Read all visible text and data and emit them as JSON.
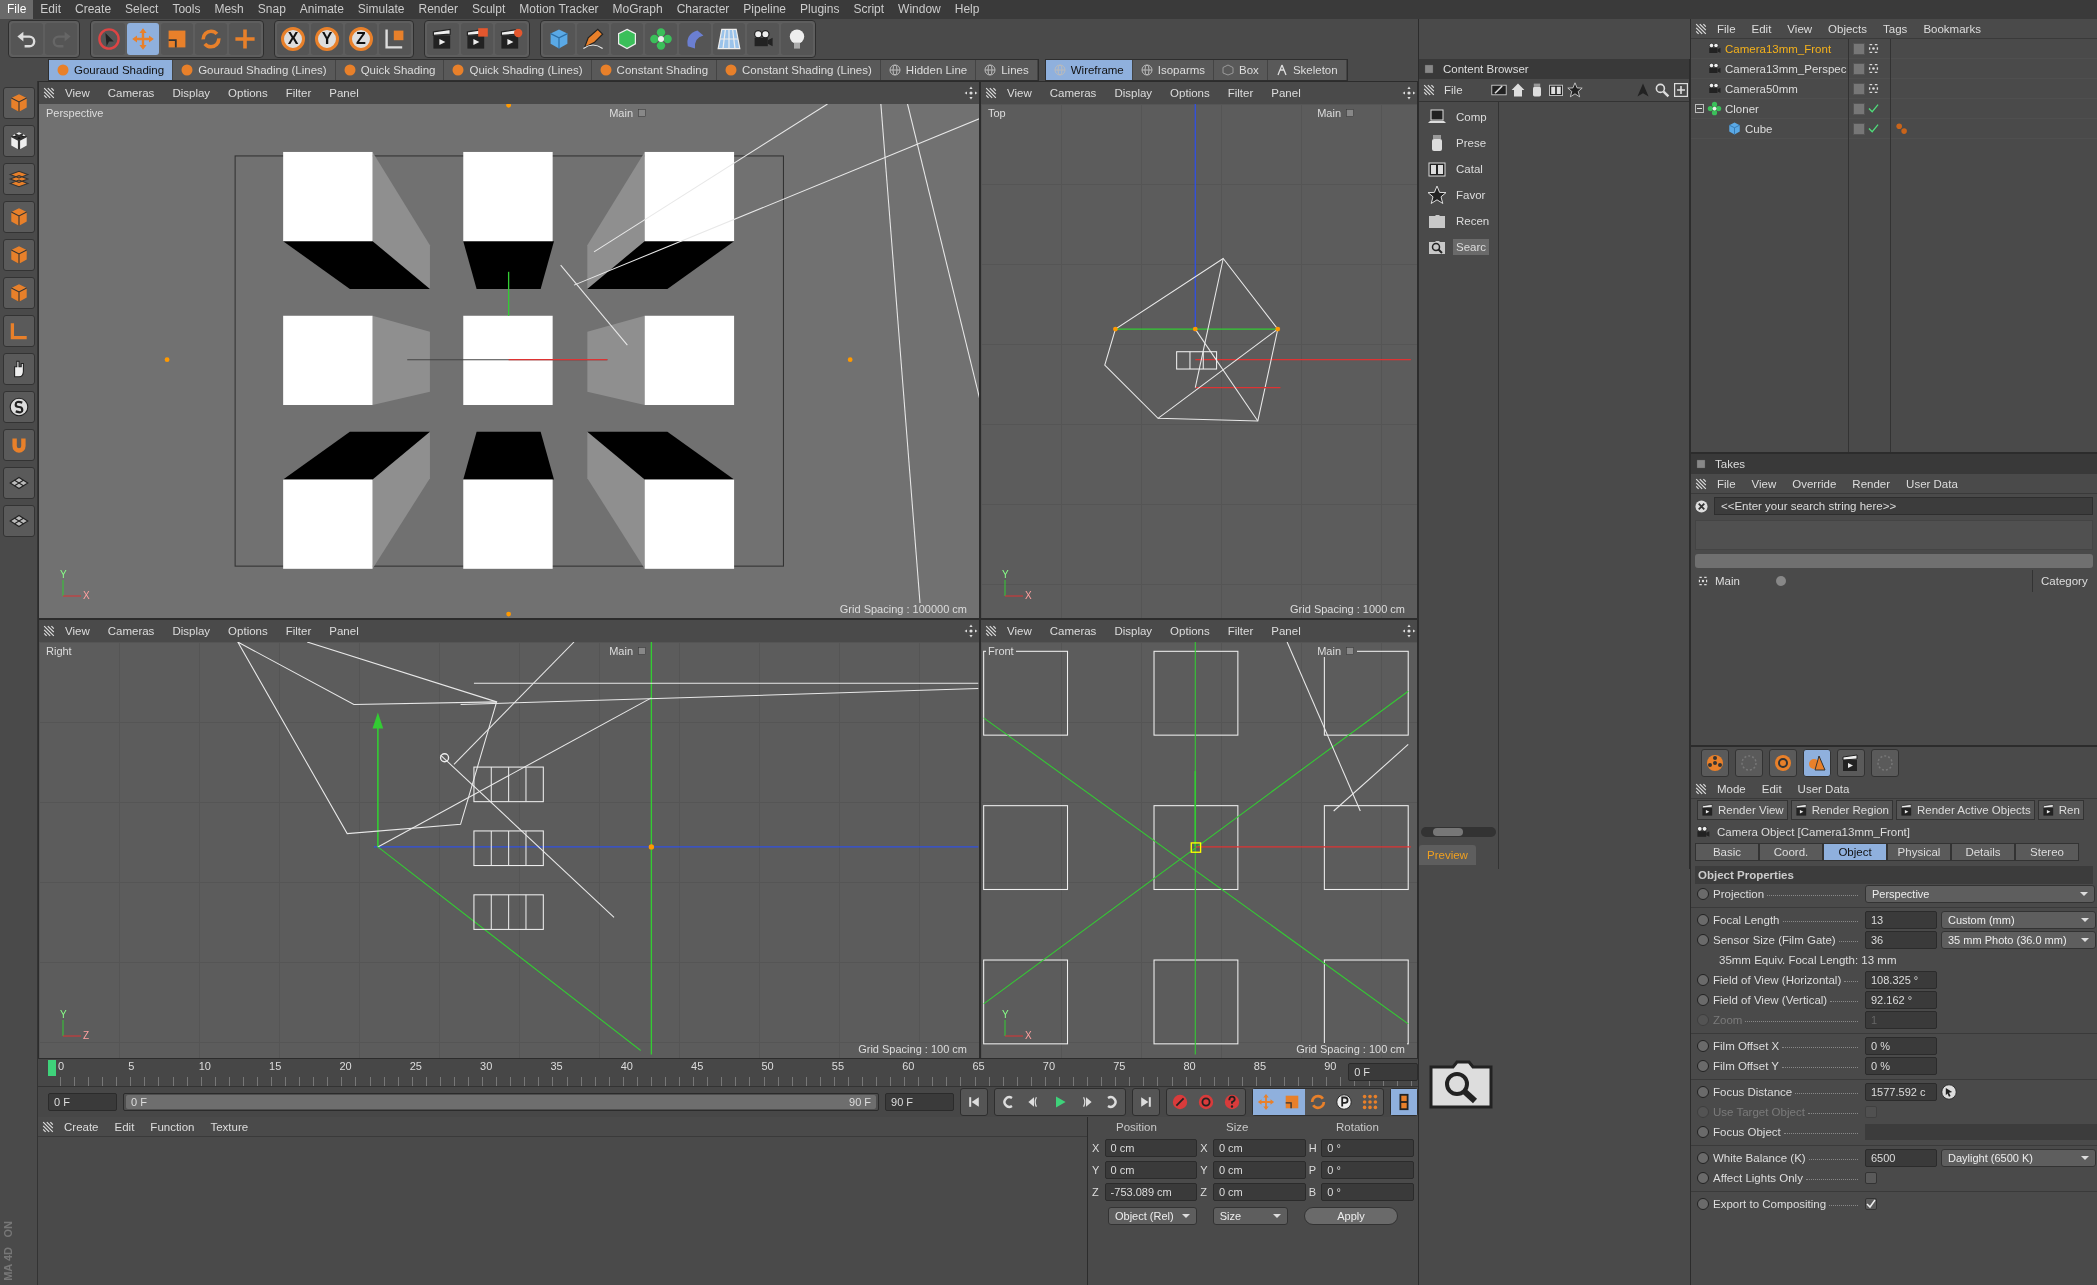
{
  "menu": [
    {
      "label": "File",
      "selected": true
    },
    {
      "label": "Edit",
      "selected": false
    },
    {
      "label": "Create",
      "selected": false
    },
    {
      "label": "Select",
      "selected": false
    },
    {
      "label": "Tools",
      "selected": false
    },
    {
      "label": "Mesh",
      "selected": false
    },
    {
      "label": "Snap",
      "selected": false
    },
    {
      "label": "Animate",
      "selected": false
    },
    {
      "label": "Simulate",
      "selected": false
    },
    {
      "label": "Render",
      "selected": false
    },
    {
      "label": "Sculpt",
      "selected": false
    },
    {
      "label": "Motion Tracker",
      "selected": false
    },
    {
      "label": "MoGraph",
      "selected": false
    },
    {
      "label": "Character",
      "selected": false
    },
    {
      "label": "Pipeline",
      "selected": false
    },
    {
      "label": "Plugins",
      "selected": false
    },
    {
      "label": "Script",
      "selected": false
    },
    {
      "label": "Window",
      "selected": false
    },
    {
      "label": "Help",
      "selected": false
    }
  ],
  "toolbar": [
    [
      {
        "kind": "undo",
        "selected": false
      },
      {
        "kind": "redo",
        "selected": false
      }
    ],
    [
      {
        "kind": "select",
        "selected": false
      },
      {
        "kind": "move",
        "selected": true
      },
      {
        "kind": "scale",
        "selected": false
      },
      {
        "kind": "rotate",
        "selected": false
      },
      {
        "kind": "transform",
        "selected": false
      }
    ],
    [
      {
        "kind": "axis",
        "label": "X",
        "selected": false
      },
      {
        "kind": "axis",
        "label": "Y",
        "selected": false
      },
      {
        "kind": "axis",
        "label": "Z",
        "selected": false
      },
      {
        "kind": "coord",
        "selected": false
      }
    ],
    [
      {
        "kind": "render-view",
        "selected": false
      },
      {
        "kind": "render-picture",
        "selected": false
      },
      {
        "kind": "render-settings",
        "selected": false
      }
    ],
    [
      {
        "kind": "cube",
        "selected": false
      },
      {
        "kind": "pen",
        "selected": false
      },
      {
        "kind": "subdivision",
        "selected": false
      },
      {
        "kind": "cloner",
        "selected": false
      },
      {
        "kind": "deformer",
        "selected": false
      },
      {
        "kind": "floor",
        "selected": false
      },
      {
        "kind": "camera",
        "selected": false
      },
      {
        "kind": "light",
        "selected": false
      }
    ]
  ],
  "shading_modes": [
    {
      "label": "Gouraud Shading",
      "kind": "shaded",
      "selected": true
    },
    {
      "label": "Gouraud Shading (Lines)",
      "kind": "shaded",
      "selected": false
    },
    {
      "label": "Quick Shading",
      "kind": "shaded",
      "selected": false
    },
    {
      "label": "Quick Shading (Lines)",
      "kind": "shaded",
      "selected": false
    },
    {
      "label": "Constant Shading",
      "kind": "shaded",
      "selected": false
    },
    {
      "label": "Constant Shading (Lines)",
      "kind": "shaded",
      "selected": false
    },
    {
      "label": "Hidden Line",
      "kind": "wire",
      "selected": false
    },
    {
      "label": "Lines",
      "kind": "wire",
      "selected": false
    }
  ],
  "display_modes": [
    {
      "label": "Wireframe",
      "kind": "wire",
      "selected": true
    },
    {
      "label": "Isoparms",
      "kind": "wire",
      "selected": false
    },
    {
      "label": "Box",
      "kind": "box",
      "selected": false
    },
    {
      "label": "Skeleton",
      "kind": "skeleton",
      "selected": false
    }
  ],
  "viewports": [
    {
      "kind": "perspective",
      "menu": [
        "View",
        "Cameras",
        "Display",
        "Options",
        "Filter",
        "Panel"
      ],
      "label": "Perspective",
      "camera": "Main",
      "grid_spacing": "Grid Spacing : 100000 cm",
      "gizmo": [
        "Y",
        "X"
      ]
    },
    {
      "kind": "top",
      "menu": [
        "View",
        "Cameras",
        "Display",
        "Options",
        "Filter",
        "Panel"
      ],
      "label": "Top",
      "camera": "Main",
      "grid_spacing": "Grid Spacing : 1000 cm",
      "gizmo": [
        "Y",
        "X"
      ]
    },
    {
      "kind": "right",
      "menu": [
        "View",
        "Cameras",
        "Display",
        "Options",
        "Filter",
        "Panel"
      ],
      "label": "Right",
      "camera": "Main",
      "grid_spacing": "Grid Spacing : 100 cm",
      "gizmo": [
        "Y",
        "Z"
      ]
    },
    {
      "kind": "front",
      "menu": [
        "View",
        "Cameras",
        "Display",
        "Options",
        "Filter",
        "Panel"
      ],
      "label": "Front",
      "camera": "Main",
      "grid_spacing": "Grid Spacing : 100 cm",
      "gizmo": [
        "Y",
        "X"
      ]
    }
  ],
  "timeline": {
    "level": 1,
    "ticks": [
      "0",
      "5",
      "10",
      "15",
      "20",
      "25",
      "30",
      "35",
      "40",
      "45",
      "50",
      "55",
      "60",
      "65",
      "70",
      "75",
      "80",
      "85",
      "90"
    ],
    "current_frame": "0 F",
    "start": "0 F",
    "range_start": "0 F",
    "range_end": "90 F",
    "end": "90 F"
  },
  "materials": {
    "menu": [
      "Create",
      "Edit",
      "Function",
      "Texture"
    ]
  },
  "coordinates": {
    "headers": [
      "Position",
      "Size",
      "Rotation"
    ],
    "rows": [
      {
        "axis": "X",
        "position": "0 cm",
        "size_axis": "X",
        "size": "0 cm",
        "rot_axis": "H",
        "rotation": "0 °"
      },
      {
        "axis": "Y",
        "position": "0 cm",
        "size_axis": "Y",
        "size": "0 cm",
        "rot_axis": "P",
        "rotation": "0 °"
      },
      {
        "axis": "Z",
        "position": "-753.089 cm",
        "size_axis": "Z",
        "size": "0 cm",
        "rot_axis": "B",
        "rotation": "0 °"
      }
    ],
    "mode": "Object (Rel)",
    "size_mode": "Size",
    "apply": "Apply"
  },
  "logo": [
    "ON",
    "MA 4D"
  ],
  "content_browser": {
    "title": "Content Browser",
    "menu": [
      "File"
    ],
    "items": [
      {
        "label": "Comp",
        "kind": "computer",
        "selected": false
      },
      {
        "label": "Prese",
        "kind": "jar",
        "selected": false
      },
      {
        "label": "Catal",
        "kind": "book",
        "selected": false
      },
      {
        "label": "Favor",
        "kind": "star",
        "selected": false
      },
      {
        "label": "Recen",
        "kind": "folder",
        "selected": false
      },
      {
        "label": "Searc",
        "kind": "search-folder",
        "selected": true
      }
    ],
    "preview": "Preview"
  },
  "objects": {
    "menu": [
      "File",
      "Edit",
      "View",
      "Objects",
      "Tags",
      "Bookmarks"
    ],
    "items": [
      {
        "name": "Camera13mm_Front",
        "kind": "camera",
        "selected": true,
        "check": false,
        "tag": false
      },
      {
        "name": "Camera13mm_Perspec",
        "kind": "camera",
        "selected": false,
        "check": false,
        "tag": false
      },
      {
        "name": "Camera50mm",
        "kind": "camera",
        "selected": false,
        "check": false,
        "tag": false
      },
      {
        "name": "Cloner",
        "kind": "cloner",
        "selected": false,
        "check": true,
        "tag": false,
        "expanded": true,
        "children": [
          {
            "name": "Cube",
            "kind": "cube",
            "selected": false,
            "check": true,
            "tag": true
          }
        ]
      }
    ]
  },
  "takes": {
    "title": "Takes",
    "menu": [
      "File",
      "View",
      "Override",
      "Render",
      "User Data"
    ],
    "placeholder": "<<Enter your search string here>>",
    "items": [
      {
        "name": "Main"
      }
    ],
    "column": "Category"
  },
  "attributes": {
    "menu": [
      "Mode",
      "Edit",
      "User Data"
    ],
    "render_buttons": [
      "Render View",
      "Render Region",
      "Render Active Objects",
      "Ren"
    ],
    "title": "Camera Object [Camera13mm_Front]",
    "tabs": [
      {
        "label": "Basic",
        "selected": false
      },
      {
        "label": "Coord.",
        "selected": false
      },
      {
        "label": "Object",
        "selected": true
      },
      {
        "label": "Physical",
        "selected": false
      },
      {
        "label": "Details",
        "selected": false
      },
      {
        "label": "Stereo",
        "selected": false
      }
    ],
    "section": "Object Properties",
    "properties": [
      {
        "kind": "dropdown",
        "label": "Projection",
        "dropdown": "Perspective",
        "disabled": false,
        "divider_before": false
      },
      {
        "kind": "number_dropdown",
        "label": "Focal Length",
        "value": "13",
        "dropdown": "Custom (mm)",
        "disabled": false,
        "divider_before": true
      },
      {
        "kind": "number_dropdown",
        "label": "Sensor Size (Film Gate)",
        "value": "36",
        "dropdown": "35 mm Photo (36.0 mm)",
        "disabled": false,
        "divider_before": false
      },
      {
        "kind": "info",
        "label": "35mm Equiv. Focal Length: 13 mm",
        "disabled": false,
        "divider_before": false
      },
      {
        "kind": "number",
        "label": "Field of View (Horizontal)",
        "value": "108.325 °",
        "disabled": false,
        "divider_before": false
      },
      {
        "kind": "number",
        "label": "Field of View (Vertical)",
        "value": "92.162 °",
        "disabled": false,
        "divider_before": false
      },
      {
        "kind": "number",
        "label": "Zoom",
        "value": "1",
        "disabled": true,
        "divider_before": false
      },
      {
        "kind": "number",
        "label": "Film Offset X",
        "value": "0 %",
        "disabled": false,
        "divider_before": true
      },
      {
        "kind": "number",
        "label": "Film Offset Y",
        "value": "0 %",
        "disabled": false,
        "divider_before": false
      },
      {
        "kind": "number_pick",
        "label": "Focus Distance",
        "value": "1577.592 c",
        "disabled": false,
        "divider_before": true
      },
      {
        "kind": "checkbox",
        "label": "Use Target Object",
        "checked": false,
        "disabled": true,
        "divider_before": false
      },
      {
        "kind": "link",
        "label": "Focus Object",
        "disabled": false,
        "divider_before": false
      },
      {
        "kind": "number_dropdown",
        "label": "White Balance (K)",
        "value": "6500",
        "dropdown": "Daylight (6500 K)",
        "disabled": false,
        "divider_before": true
      },
      {
        "kind": "checkbox",
        "label": "Affect Lights Only",
        "checked": false,
        "disabled": false,
        "divider_before": false
      },
      {
        "kind": "checkbox",
        "label": "Export to Compositing",
        "checked": true,
        "disabled": false,
        "divider_before": true
      }
    ]
  }
}
